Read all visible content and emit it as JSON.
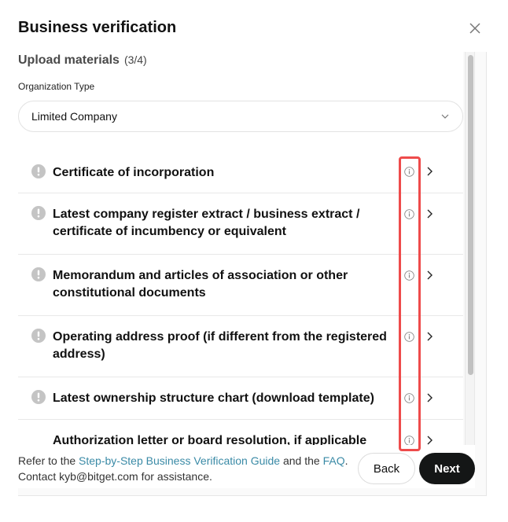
{
  "dialog": {
    "title": "Business verification",
    "close_icon": "close-icon"
  },
  "section": {
    "title": "Upload materials",
    "step": "(3/4)"
  },
  "organization_type": {
    "label": "Organization Type",
    "value": "Limited Company"
  },
  "documents": [
    {
      "label": "Certificate of incorporation",
      "status": "missing"
    },
    {
      "label": "Latest company register extract / business extract / certificate of incumbency or equivalent",
      "status": "missing"
    },
    {
      "label": "Memorandum and articles of association or other constitutional documents",
      "status": "missing"
    },
    {
      "label": "Operating address proof (if different from the registered address)",
      "status": "missing"
    },
    {
      "label": "Latest ownership structure chart (download template)",
      "status": "missing"
    },
    {
      "label": "Authorization letter or board resolution, if applicable",
      "status": "missing"
    }
  ],
  "footer": {
    "text_before": "Refer to the ",
    "guide_link": "Step-by-Step Business Verification Guide",
    "text_middle": " and the ",
    "faq_link": "FAQ",
    "text_after": ".",
    "contact": "Contact kyb@bitget.com for assistance."
  },
  "buttons": {
    "back": "Back",
    "next": "Next"
  },
  "colors": {
    "accent_link": "#3a8aa6",
    "primary_button": "#141616",
    "highlight": "#ee4b4b",
    "status_icon": "#c4c4c4"
  }
}
